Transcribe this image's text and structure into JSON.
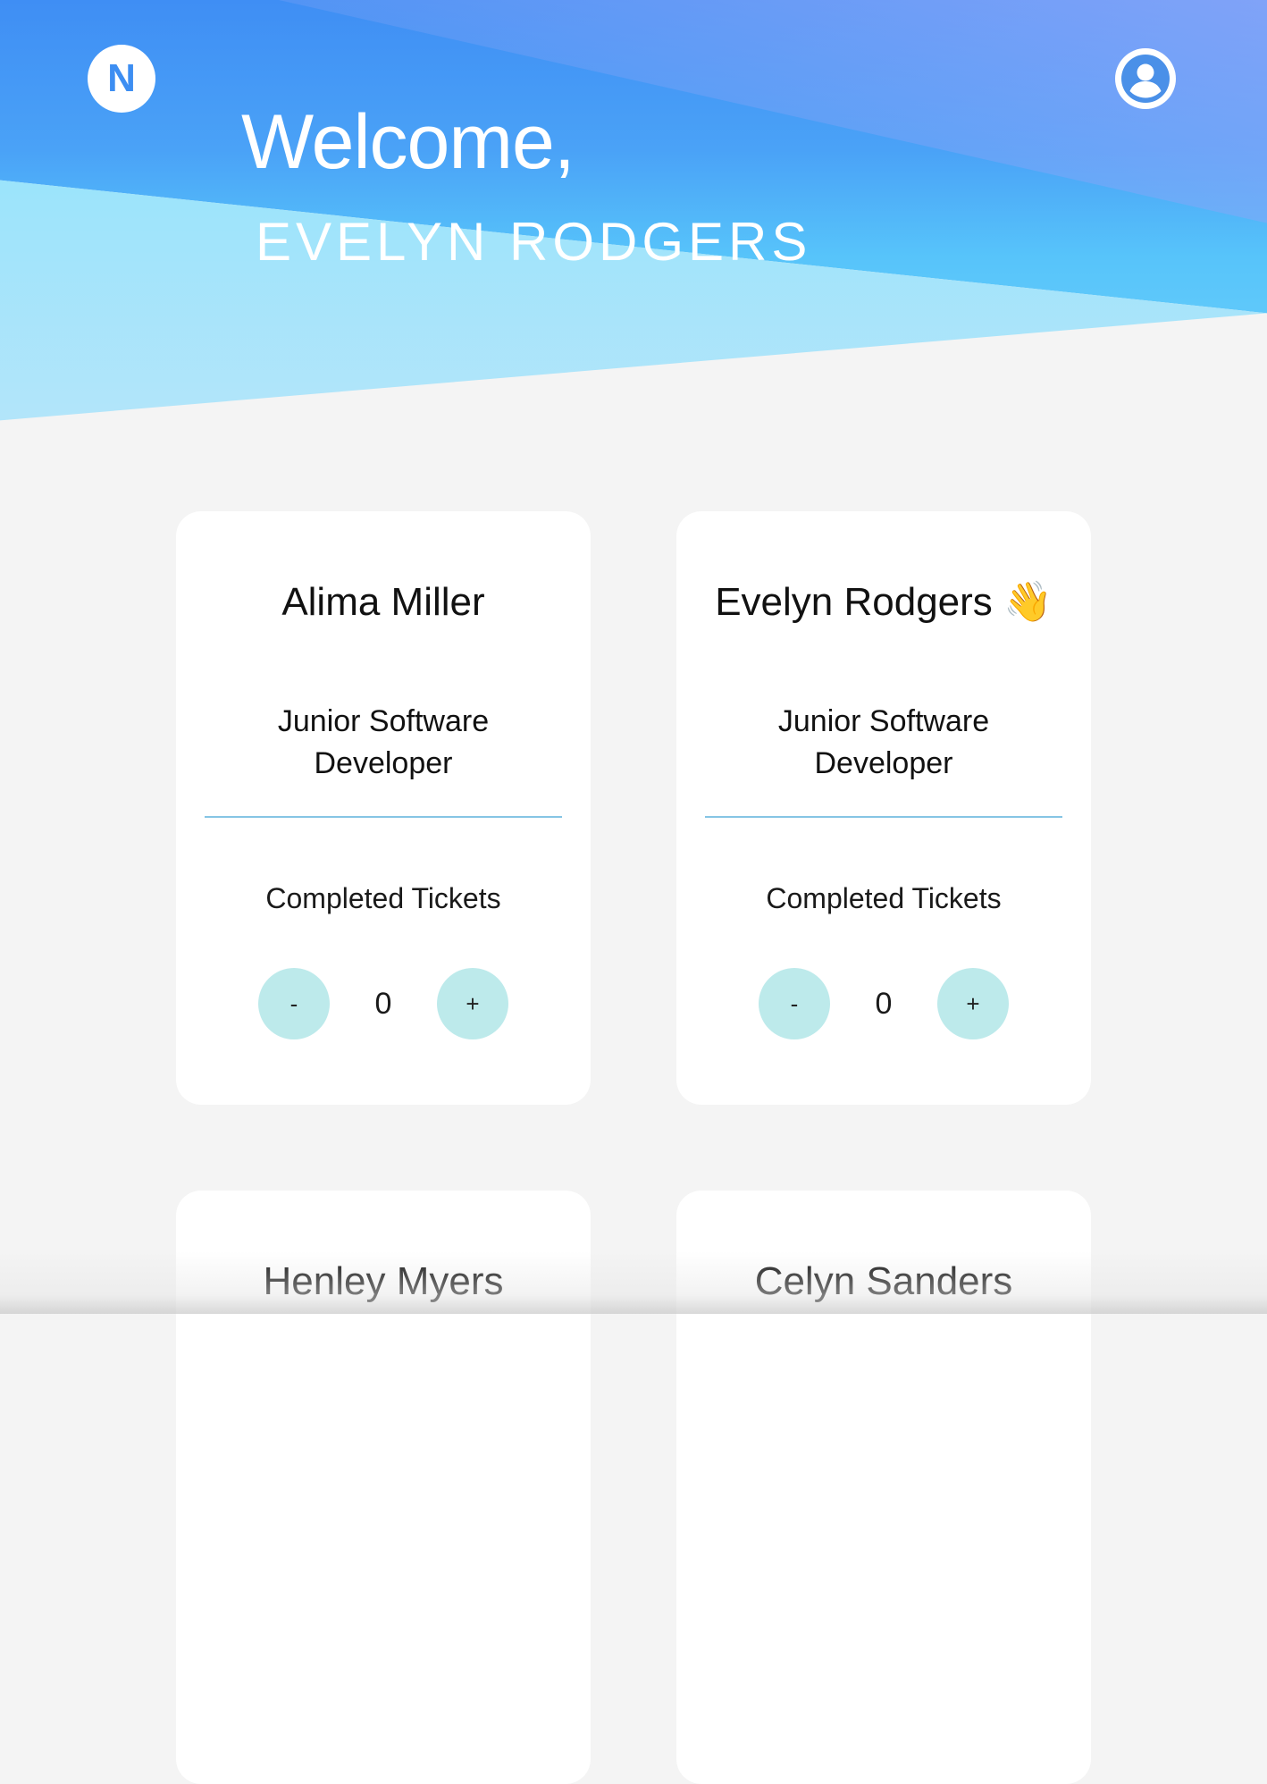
{
  "header": {
    "logo_letter": "N",
    "avatar_icon": "user-circle-icon",
    "welcome_text": "Welcome,",
    "user_name": "EVELYN RODGERS"
  },
  "colors": {
    "hero_blue": "#3f8ef4",
    "hero_cyan": "#7ce6ff",
    "stepper_bg": "#bdeaeb",
    "divider": "#86c5e4",
    "page_bg": "#f4f4f4"
  },
  "cards": [
    {
      "name": "Alima Miller",
      "role": "Junior Software Developer",
      "counter_label": "Completed Tickets",
      "count": "0",
      "decrement_label": "-",
      "increment_label": "+"
    },
    {
      "name": "Evelyn Rodgers 👋",
      "role": "Junior Software Developer",
      "counter_label": "Completed Tickets",
      "count": "0",
      "decrement_label": "-",
      "increment_label": "+"
    },
    {
      "name": "Henley Myers"
    },
    {
      "name": "Celyn Sanders"
    }
  ]
}
